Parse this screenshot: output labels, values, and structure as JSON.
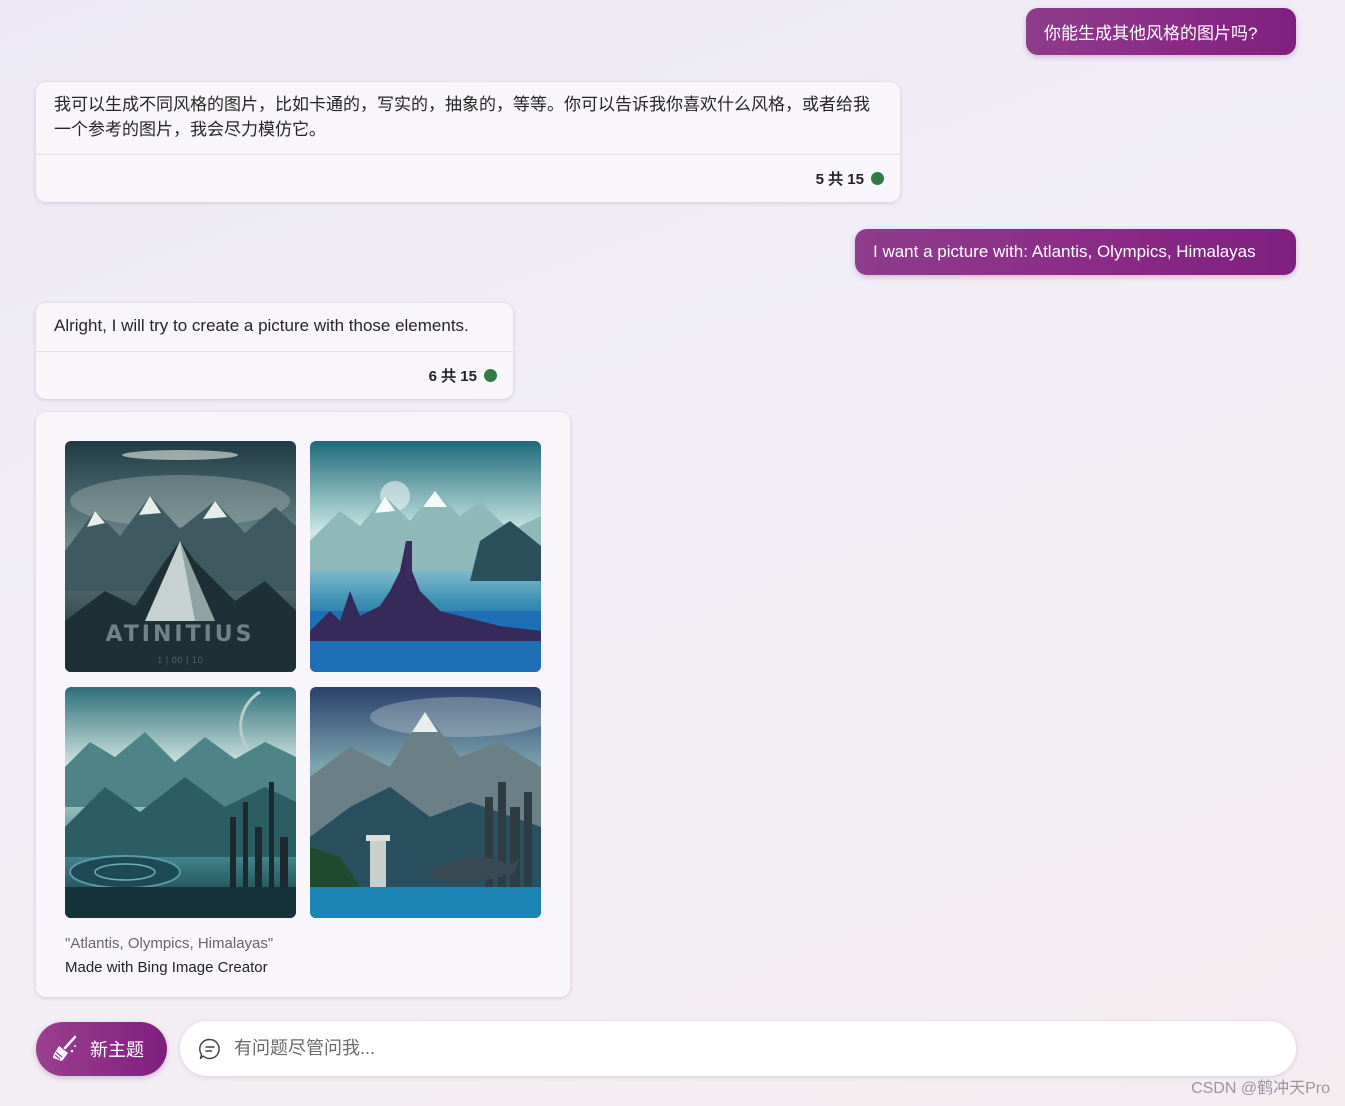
{
  "messages": {
    "user1": "你能生成其他风格的图片吗?",
    "bot1": {
      "text": "我可以生成不同风格的图片，比如卡通的，写实的，抽象的，等等。你可以告诉我你喜欢什么风格，或者给我一个参考的图片，我会尽力模仿它。",
      "count": "5 共 15"
    },
    "user2": "I want a picture with: Atlantis, Olympics, Himalayas",
    "bot2": {
      "text": "Alright, I will try to create a picture with those elements.",
      "count": "6 共 15"
    }
  },
  "image_card": {
    "image1_text": "ATINITIUS",
    "image1_subtext": "1 | 00 | 10",
    "caption_prompt": "\"Atlantis, Olympics, Himalayas\"",
    "caption_made": "Made with Bing Image Creator"
  },
  "composer": {
    "new_topic_label": "新主题",
    "input_placeholder": "有问题尽管问我..."
  },
  "watermark": "CSDN @鹤冲天Pro",
  "colors": {
    "accent": "#8a2a86",
    "status_dot": "#2f7a45"
  }
}
